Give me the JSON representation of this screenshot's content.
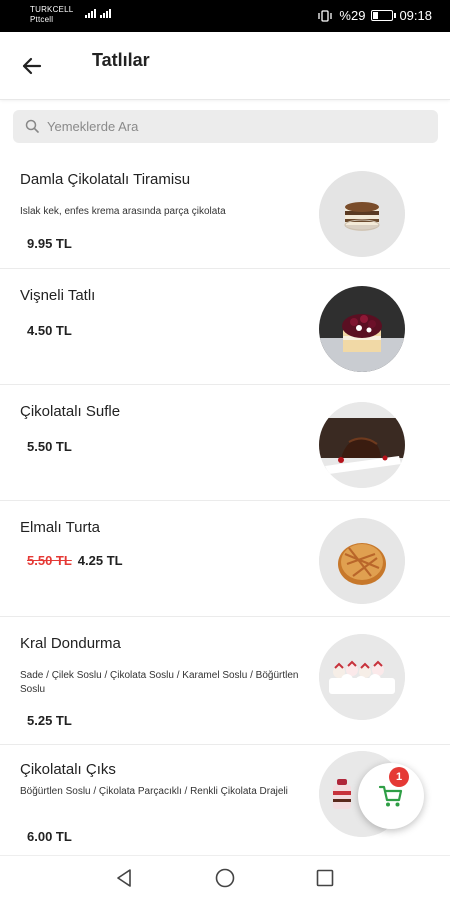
{
  "status_bar": {
    "carrier_line1": "TURKCELL",
    "carrier_line2": "Pttcell",
    "network": "4.5G",
    "battery_text": "%29",
    "battery_level": 0.29,
    "time": "09:18"
  },
  "header": {
    "title": "Tatlılar",
    "back_icon": "arrow-left-icon"
  },
  "search": {
    "placeholder": "Yemeklerde Ara",
    "value": ""
  },
  "items": [
    {
      "name": "Damla Çikolatalı Tiramisu",
      "description": "Islak kek, enfes krema arasında parça çikolata",
      "old_price": "",
      "price": "9.95 TL"
    },
    {
      "name": "Vişneli Tatlı",
      "description": "",
      "old_price": "",
      "price": "4.50 TL"
    },
    {
      "name": "Çikolatalı Sufle",
      "description": "",
      "old_price": "",
      "price": "5.50 TL"
    },
    {
      "name": "Elmalı Turta",
      "description": "",
      "old_price": "5.50 TL",
      "price": "4.25 TL"
    },
    {
      "name": "Kral Dondurma",
      "description": "Sade / Çilek Soslu / Çikolata Soslu / Karamel Soslu / Böğürtlen Soslu",
      "old_price": "",
      "price": "5.25 TL"
    },
    {
      "name": "Çikolatalı Çıks",
      "description": "Böğürtlen Soslu / Çikolata Parçacıklı / Renkli Çikolata Drajeli",
      "old_price": "",
      "price": "6.00 TL"
    }
  ],
  "cart": {
    "count": "1",
    "accent_color": "#2e9e45",
    "badge_color": "#e53935"
  },
  "nav": {
    "back": "triangle-back-icon",
    "home": "circle-home-icon",
    "recents": "square-recents-icon"
  }
}
